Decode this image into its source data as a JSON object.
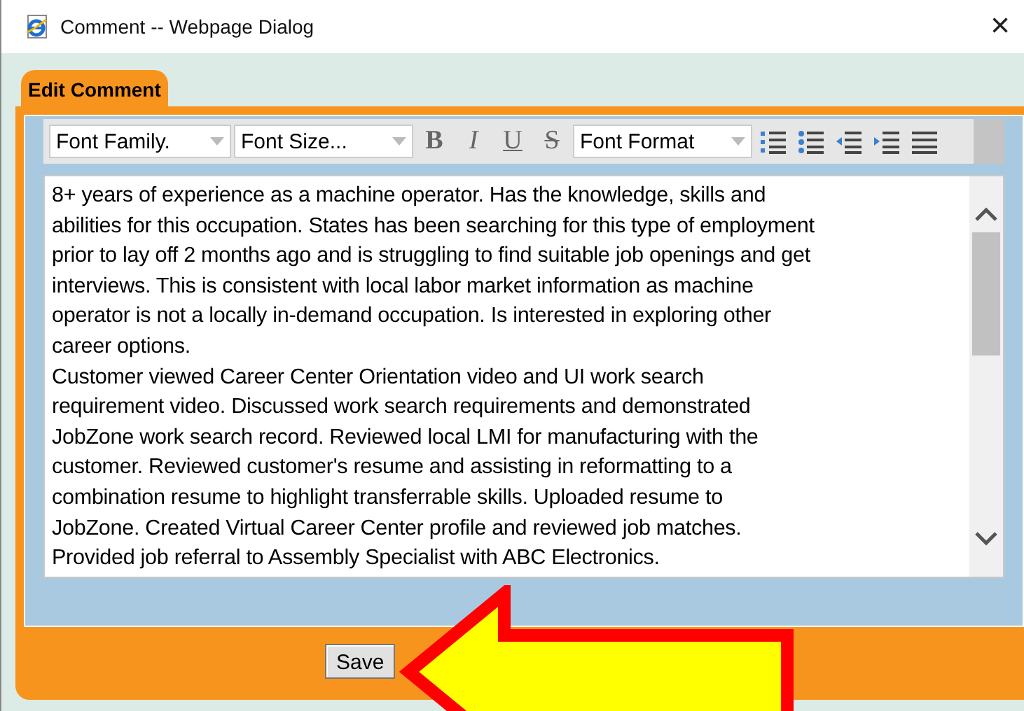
{
  "window": {
    "title": "Comment -- Webpage Dialog",
    "close": "×"
  },
  "tabs": [
    {
      "label": "Edit Comment",
      "selected": true
    }
  ],
  "toolbar": [
    {
      "kind": "select",
      "label": "Font Family."
    },
    {
      "kind": "select",
      "label": "Font Size..."
    },
    {
      "kind": "bold",
      "label": "B"
    },
    {
      "kind": "italic",
      "label": "I"
    },
    {
      "kind": "underline",
      "label": "U"
    },
    {
      "kind": "strike",
      "label": "S"
    },
    {
      "kind": "select",
      "label": "Font Format"
    },
    {
      "kind": "numbered-list"
    },
    {
      "kind": "bulleted-list"
    },
    {
      "kind": "outdent"
    },
    {
      "kind": "indent"
    },
    {
      "kind": "justify"
    }
  ],
  "editor": {
    "paragraphs": [
      {
        "lines": [
          "8+ years of experience as a machine operator. Has the knowledge, skills and",
          "abilities for this occupation. States has been searching for this type of employment",
          "prior to lay off 2 months ago and is struggling to find suitable job openings and get",
          "interviews. This is consistent with local labor market information as machine",
          "operator is not a locally in-demand occupation. Is interested in exploring other",
          "career options."
        ]
      },
      {
        "lines": [
          "Customer viewed Career Center Orientation video and UI work search",
          "requirement video. Discussed work search requirements and demonstrated",
          "JobZone work search record. Reviewed local LMI for manufacturing with the",
          "customer. Reviewed customer's resume and assisting in reformatting to a",
          "combination resume to highlight transferrable skills. Uploaded resume to",
          "JobZone. Created Virtual Career Center profile and reviewed job matches.",
          "Provided job referral to Assembly Specialist with ABC Electronics."
        ]
      }
    ]
  },
  "buttons": [
    {
      "label": "Save"
    }
  ]
}
